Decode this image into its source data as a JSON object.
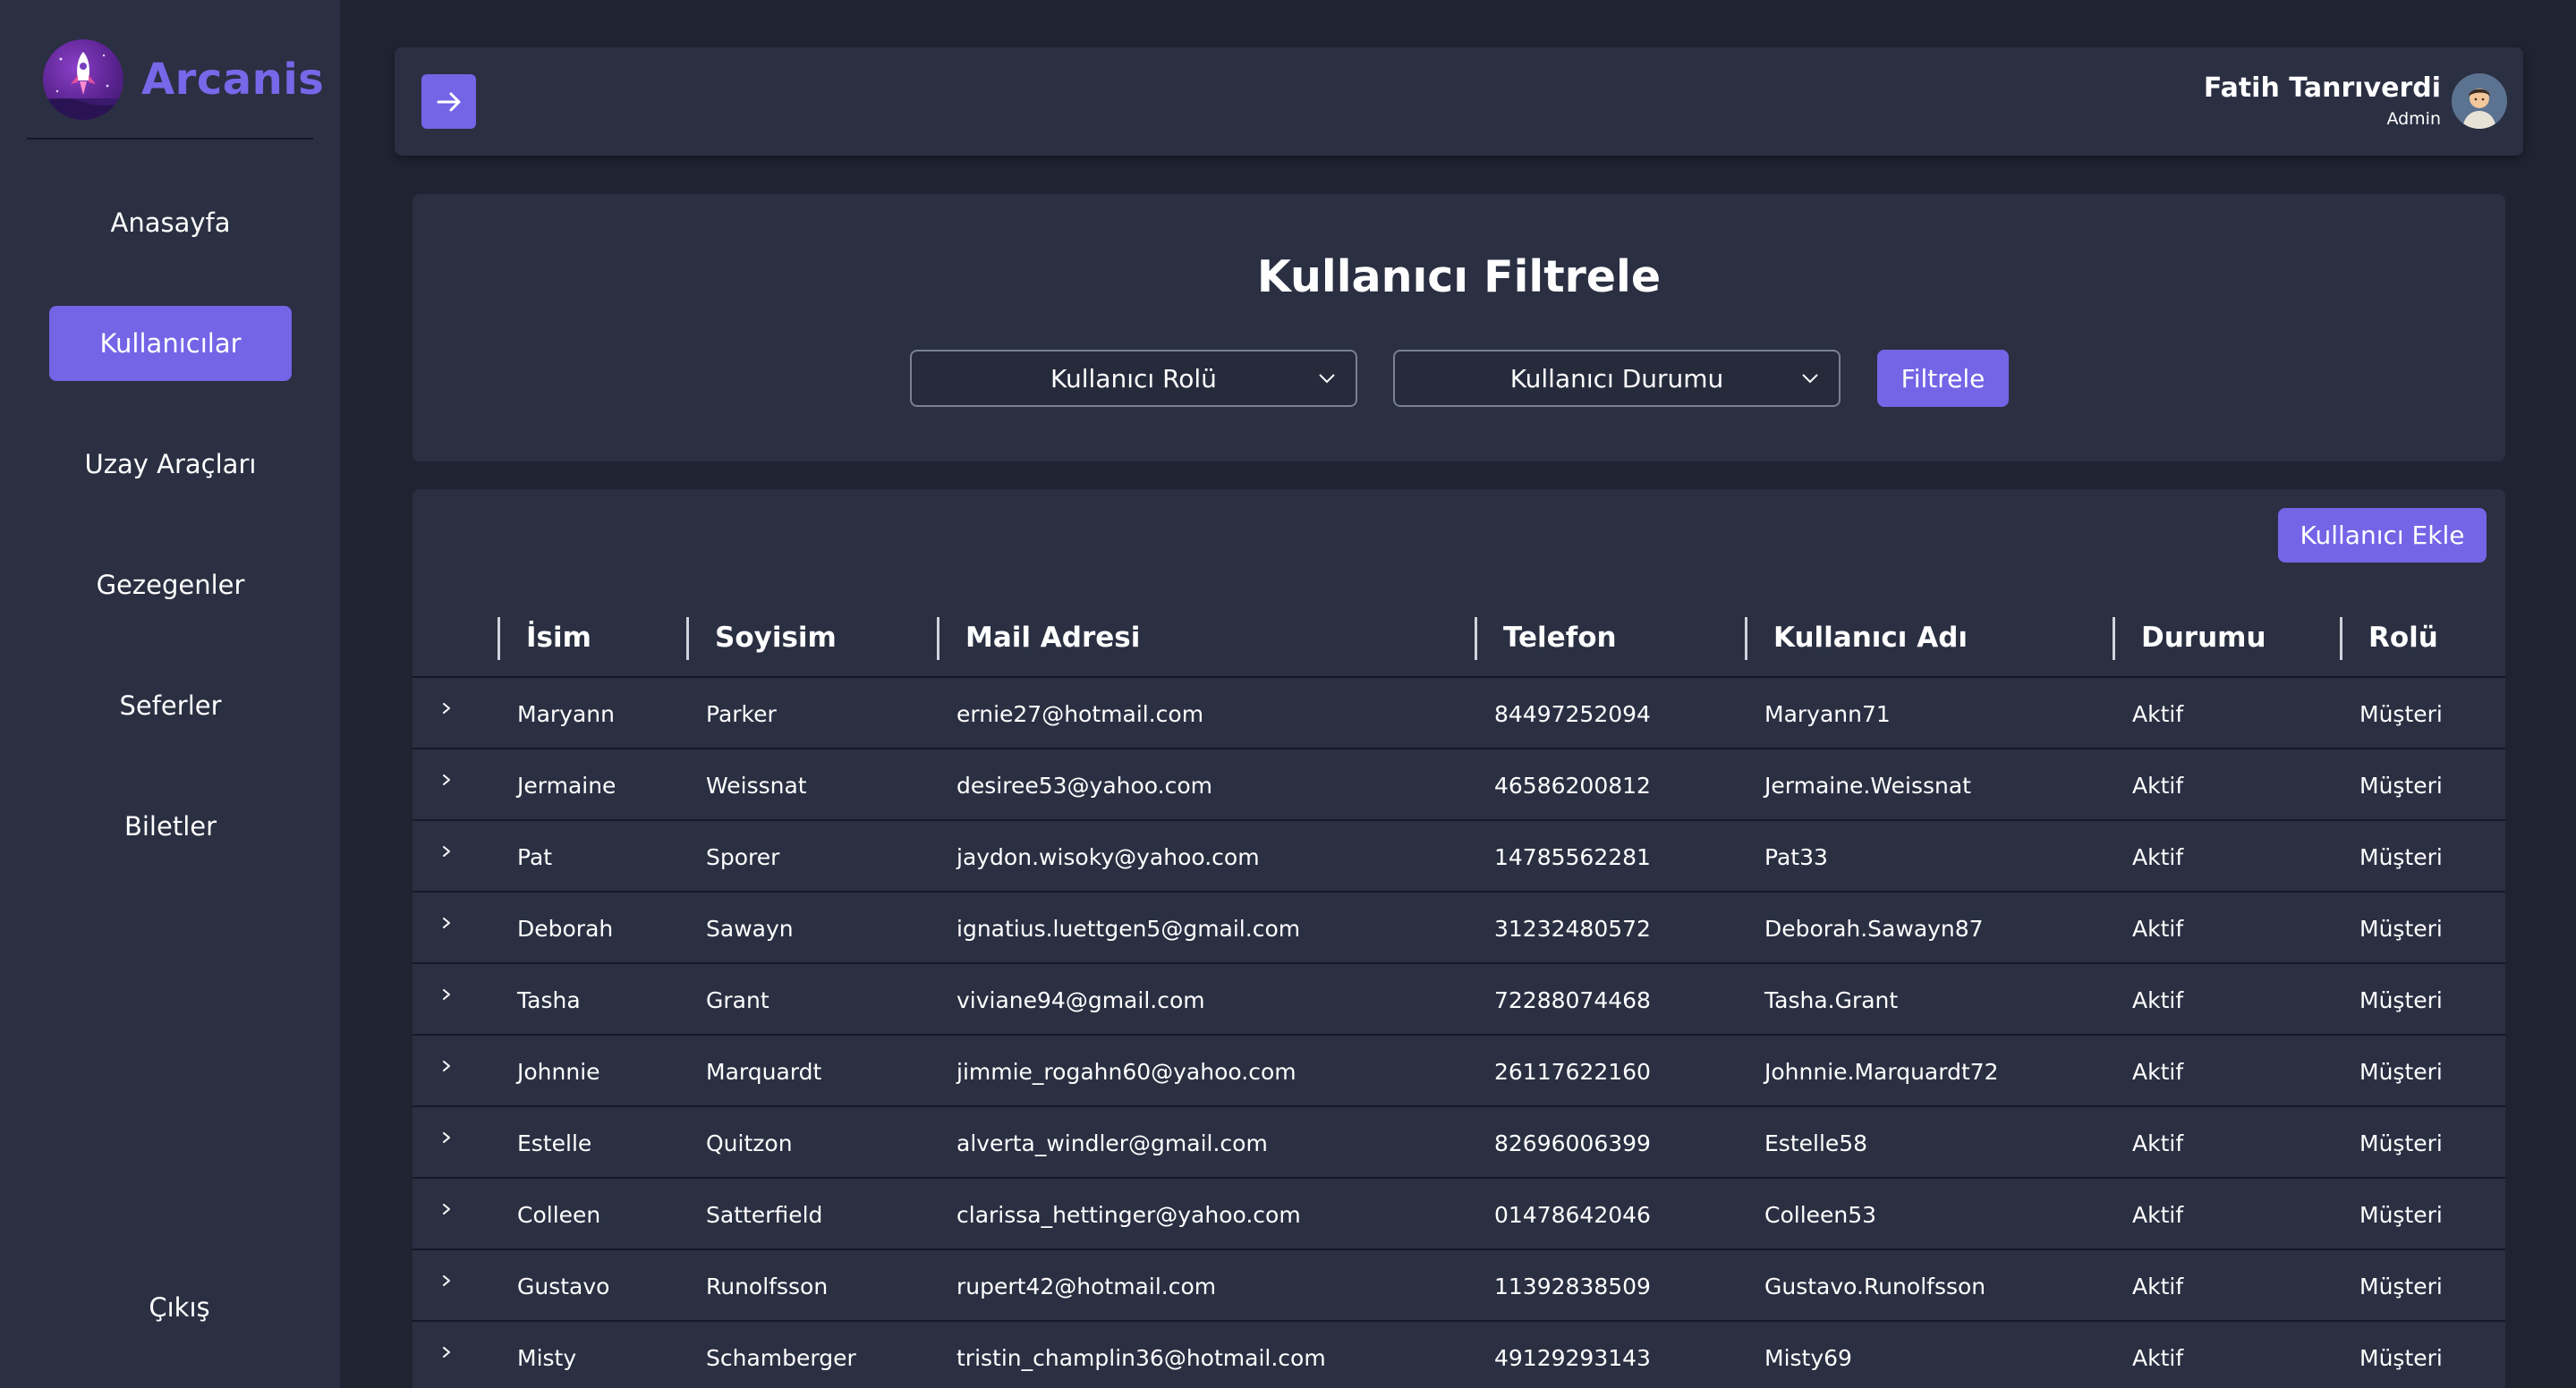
{
  "brand": {
    "name": "Arcanis",
    "logo_icon": "rocket-icon"
  },
  "sidebar": {
    "items": [
      {
        "label": "Anasayfa",
        "active": false
      },
      {
        "label": "Kullanıcılar",
        "active": true
      },
      {
        "label": "Uzay Araçları",
        "active": false
      },
      {
        "label": "Gezegenler",
        "active": false
      },
      {
        "label": "Seferler",
        "active": false
      },
      {
        "label": "Biletler",
        "active": false
      }
    ],
    "logout_label": "Çıkış"
  },
  "header": {
    "toggle_icon": "arrow-right-icon",
    "user_name": "Fatih Tanrıverdi",
    "user_role": "Admin"
  },
  "filter": {
    "title": "Kullanıcı Filtrele",
    "role_select": "Kullanıcı Rolü",
    "status_select": "Kullanıcı Durumu",
    "button_label": "Filtrele"
  },
  "table": {
    "add_button_label": "Kullanıcı Ekle",
    "columns": [
      "İsim",
      "Soyisim",
      "Mail Adresi",
      "Telefon",
      "Kullanıcı Adı",
      "Durumu",
      "Rolü"
    ],
    "rows": [
      [
        "Maryann",
        "Parker",
        "ernie27@hotmail.com",
        "84497252094",
        "Maryann71",
        "Aktif",
        "Müşteri"
      ],
      [
        "Jermaine",
        "Weissnat",
        "desiree53@yahoo.com",
        "46586200812",
        "Jermaine.Weissnat",
        "Aktif",
        "Müşteri"
      ],
      [
        "Pat",
        "Sporer",
        "jaydon.wisoky@yahoo.com",
        "14785562281",
        "Pat33",
        "Aktif",
        "Müşteri"
      ],
      [
        "Deborah",
        "Sawayn",
        "ignatius.luettgen5@gmail.com",
        "31232480572",
        "Deborah.Sawayn87",
        "Aktif",
        "Müşteri"
      ],
      [
        "Tasha",
        "Grant",
        "viviane94@gmail.com",
        "72288074468",
        "Tasha.Grant",
        "Aktif",
        "Müşteri"
      ],
      [
        "Johnnie",
        "Marquardt",
        "jimmie_rogahn60@yahoo.com",
        "26117622160",
        "Johnnie.Marquardt72",
        "Aktif",
        "Müşteri"
      ],
      [
        "Estelle",
        "Quitzon",
        "alverta_windler@gmail.com",
        "82696006399",
        "Estelle58",
        "Aktif",
        "Müşteri"
      ],
      [
        "Colleen",
        "Satterfield",
        "clarissa_hettinger@yahoo.com",
        "01478642046",
        "Colleen53",
        "Aktif",
        "Müşteri"
      ],
      [
        "Gustavo",
        "Runolfsson",
        "rupert42@hotmail.com",
        "11392838509",
        "Gustavo.Runolfsson",
        "Aktif",
        "Müşteri"
      ],
      [
        "Misty",
        "Schamberger",
        "tristin_champlin36@hotmail.com",
        "49129293143",
        "Misty69",
        "Aktif",
        "Müşteri"
      ]
    ]
  },
  "colors": {
    "accent": "#7464e6",
    "brand": "#7668e8",
    "panel": "#2a2f42",
    "background": "#1f2433"
  }
}
